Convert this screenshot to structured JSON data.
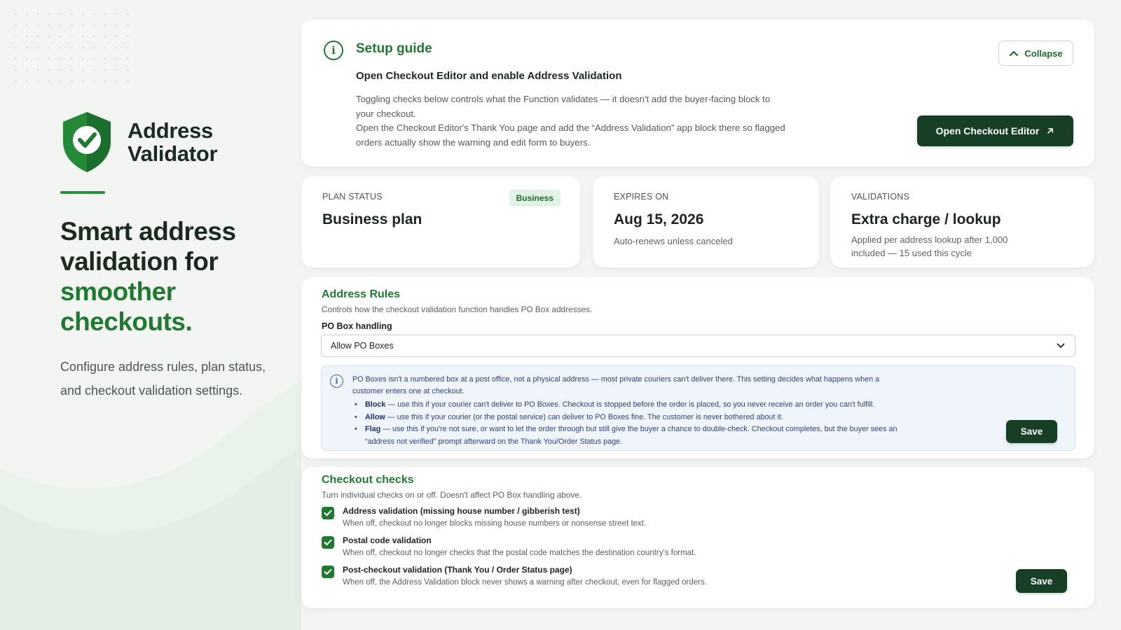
{
  "brand": {
    "name_line1": "Address",
    "name_line2": "Validator",
    "headline_line1": "Smart address",
    "headline_line2": "validation for",
    "headline_accent_line1": "smoother",
    "headline_accent_line2": "checkouts.",
    "tagline": "Configure address rules, plan status, and checkout validation settings.",
    "logo_icon": "shield-check-icon",
    "accent_color": "#1f7a30"
  },
  "setup_guide": {
    "title": "Setup guide",
    "subtitle": "Open Checkout Editor and enable Address Validation",
    "paragraph1": "Toggling checks below controls what the Function validates — it doesn't add the buyer-facing block to your checkout.",
    "paragraph2": "Open the Checkout Editor's Thank You page and add the “Address Validation” app block there so flagged orders actually show the warning and edit form to buyers.",
    "collapse_label": "Collapse",
    "open_button_label": "Open Checkout Editor"
  },
  "plan_status": {
    "label": "PLAN STATUS",
    "value": "Business plan",
    "badge": "Business"
  },
  "expires": {
    "label": "EXPIRES ON",
    "value": "Aug 15, 2026",
    "note": "Auto-renews unless canceled"
  },
  "validations": {
    "label": "VALIDATIONS",
    "value": "Extra charge / lookup",
    "note": "Applied per address lookup after 1,000 included — 15 used this cycle"
  },
  "address_rules": {
    "title": "Address Rules",
    "description": "Controls how the checkout validation function handles PO Box addresses.",
    "field_label": "PO Box handling",
    "selected_option": "Allow PO Boxes",
    "info_text": "PO Boxes isn't a numbered box at a post office, not a physical address — most private couriers can't deliver there. This setting decides what happens when a customer enters one at checkout.",
    "options_help": [
      {
        "name": "Block",
        "text": "— use this if your courier can't deliver to PO Boxes. Checkout is stopped before the order is placed, so you never receive an order you can't fulfill."
      },
      {
        "name": "Allow",
        "text": "— use this if your courier (or the postal service) can deliver to PO Boxes fine. The customer is never bothered about it."
      },
      {
        "name": "Flag",
        "text": "— use this if you're not sure, or want to let the order through but still give the buyer a chance to double-check. Checkout completes, but the buyer sees an “address not verified” prompt afterward on the Thank You/Order Status page."
      }
    ],
    "save_label": "Save"
  },
  "checkout_checks": {
    "title": "Checkout checks",
    "description": "Turn individual checks on or off. Doesn't affect PO Box handling above.",
    "items": [
      {
        "title": "Address validation (missing house number / gibberish test)",
        "desc": "When off, checkout no longer blocks missing house numbers or nonsense street text.",
        "checked": true
      },
      {
        "title": "Postal code validation",
        "desc": "When off, checkout no longer checks that the postal code matches the destination country's format.",
        "checked": true
      },
      {
        "title": "Post-checkout validation (Thank You / Order Status page)",
        "desc": "When off, the Address Validation block never shows a warning after checkout, even for flagged orders.",
        "checked": true
      }
    ],
    "save_label": "Save"
  }
}
